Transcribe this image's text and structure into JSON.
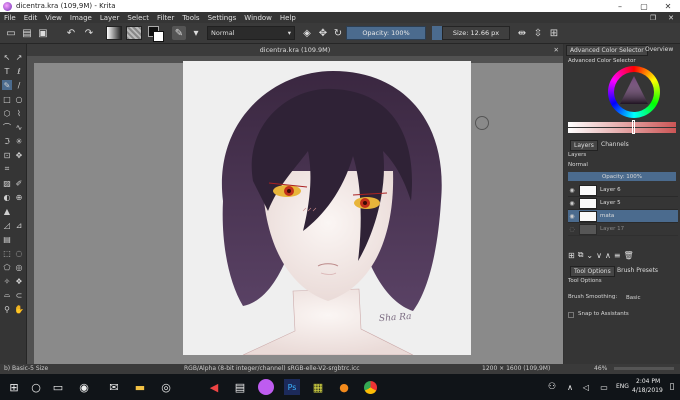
{
  "window": {
    "title": "dicentra.kra (109,9M) - Krita",
    "minimize": "–",
    "maximize": "▢",
    "close": "✕"
  },
  "menu": {
    "items": [
      "File",
      "Edit",
      "View",
      "Image",
      "Layer",
      "Select",
      "Filter",
      "Tools",
      "Settings",
      "Window",
      "Help"
    ],
    "right_restore": "❐",
    "right_close": "✕"
  },
  "toolbar": {
    "blend_mode": "Normal",
    "opacity_label": "Opacity: 100%",
    "size_label": "Size:",
    "size_value": "12.66 px"
  },
  "document": {
    "tab_title": "dicentra.kra (109.9M)",
    "tab_close": "✕"
  },
  "artwork": {
    "signature": "Sha Ra"
  },
  "docker": {
    "tabs": [
      "Advanced Color Selector",
      "Overview"
    ],
    "color_selector_title": "Advanced Color Selector",
    "layer_tabs": [
      "Layers",
      "Channels"
    ],
    "layers_label": "Layers",
    "blending": "Normal",
    "layer_opacity": "Opacity: 100%",
    "layers": [
      {
        "name": "Layer 6",
        "selected": false
      },
      {
        "name": "Layer 5",
        "selected": false
      },
      {
        "name": "mata",
        "selected": true
      },
      {
        "name": "Layer 17",
        "selected": false
      }
    ],
    "tool_tabs": [
      "Tool Options",
      "Brush Presets"
    ],
    "tool_options_title": "Tool Options",
    "brush_smoothing_label": "Brush Smoothing:",
    "brush_smoothing_value": "Basic",
    "snap_label": "Snap to Assistants"
  },
  "statusbar": {
    "brush": "b) Basic-5 Size",
    "color_info": "RGB/Alpha (8-bit integer/channel)  sRGB-elle-V2-srgbtrc.icc",
    "dimensions": "1200 × 1600 (109,9M)",
    "zoom": "46%"
  },
  "taskbar": {
    "language": "ENG",
    "time": "2:04 PM",
    "date": "4/18/2019"
  }
}
